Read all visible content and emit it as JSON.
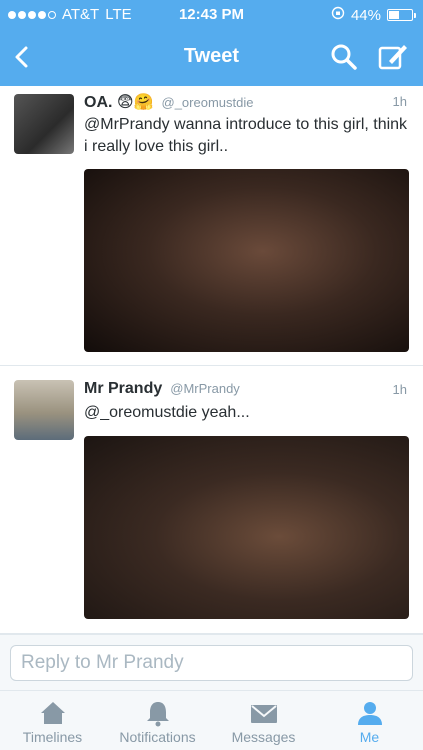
{
  "status_bar": {
    "carrier": "AT&T",
    "network": "LTE",
    "time": "12:43 PM",
    "battery": "44%",
    "battery_level": 0.44
  },
  "nav": {
    "title": "Tweet"
  },
  "tweets": [
    {
      "name": "OA. 😨🤗",
      "handle": "@_oreomustdie",
      "time": "1h",
      "text": "@MrPrandy wanna introduce to this girl, think i really love this girl.."
    },
    {
      "name": "Mr Prandy",
      "handle": "@MrPrandy",
      "time": "1h",
      "text": "@_oreomustdie yeah..."
    }
  ],
  "reply": {
    "placeholder": "Reply to Mr Prandy"
  },
  "tabs": [
    {
      "label": "Timelines"
    },
    {
      "label": "Notifications"
    },
    {
      "label": "Messages"
    },
    {
      "label": "Me"
    }
  ],
  "colors": {
    "brand": "#55acee",
    "inactive": "#8899a6"
  }
}
